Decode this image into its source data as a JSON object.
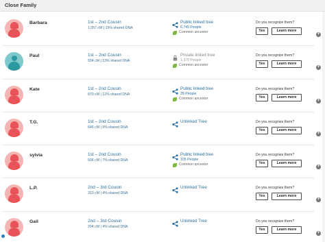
{
  "section": {
    "title": "Close Family"
  },
  "question_label": "Do you recognize them?",
  "yes_label": "Yes",
  "learn_label": "Learn more",
  "common_ancestor_label": "Common ancestor",
  "matches": [
    {
      "name": "Barbara",
      "gender": "female",
      "relationship": "1st – 2nd Cousin",
      "dna": "1,057 cM | 15% shared DNA",
      "tree": "Public linked tree",
      "tree_type": "public",
      "people": "6,745 People",
      "common_ancestor": true
    },
    {
      "name": "Paul",
      "gender": "male",
      "relationship": "1st – 2nd Cousin",
      "dna": "934 cM | 13% shared DNA",
      "tree": "Private linked tree",
      "tree_type": "private",
      "people": "1,376 People",
      "common_ancestor": true
    },
    {
      "name": "Kate",
      "gender": "female",
      "relationship": "1st – 2nd Cousin",
      "dna": "870 cM | 12% shared DNA",
      "tree": "Public linked tree",
      "tree_type": "public",
      "people": "28 People",
      "common_ancestor": true
    },
    {
      "name": "T.G.",
      "gender": "female",
      "relationship": "1st – 2nd Cousin",
      "dna": "646 cM | 9% shared DNA",
      "tree": "Unlinked Tree",
      "tree_type": "unlinked",
      "people": "",
      "common_ancestor": false
    },
    {
      "name": "sylvia",
      "gender": "female",
      "relationship": "1st – 2nd Cousin",
      "dna": "506 cM | 7% shared DNA",
      "tree": "Public linked tree",
      "tree_type": "public",
      "people": "105 People",
      "common_ancestor": true
    },
    {
      "name": "L.P.",
      "gender": "female",
      "relationship": "2nd – 3rd Cousin",
      "dna": "313 cM | 4% shared DNA",
      "tree": "Unlinked Tree",
      "tree_type": "unlinked",
      "people": "",
      "common_ancestor": false
    },
    {
      "name": "Gail",
      "gender": "female",
      "relationship": "2nd – 3rd Cousin",
      "dna": "294 cM | 4% shared DNA",
      "tree": "Unlinked Tree",
      "tree_type": "unlinked",
      "people": "",
      "common_ancestor": false
    }
  ],
  "colors": {
    "link": "#2a6fa0",
    "female_avatar": "#f4b6b4",
    "male_avatar": "#7fc8cb",
    "ancestor_leaf": "#7fb940"
  }
}
